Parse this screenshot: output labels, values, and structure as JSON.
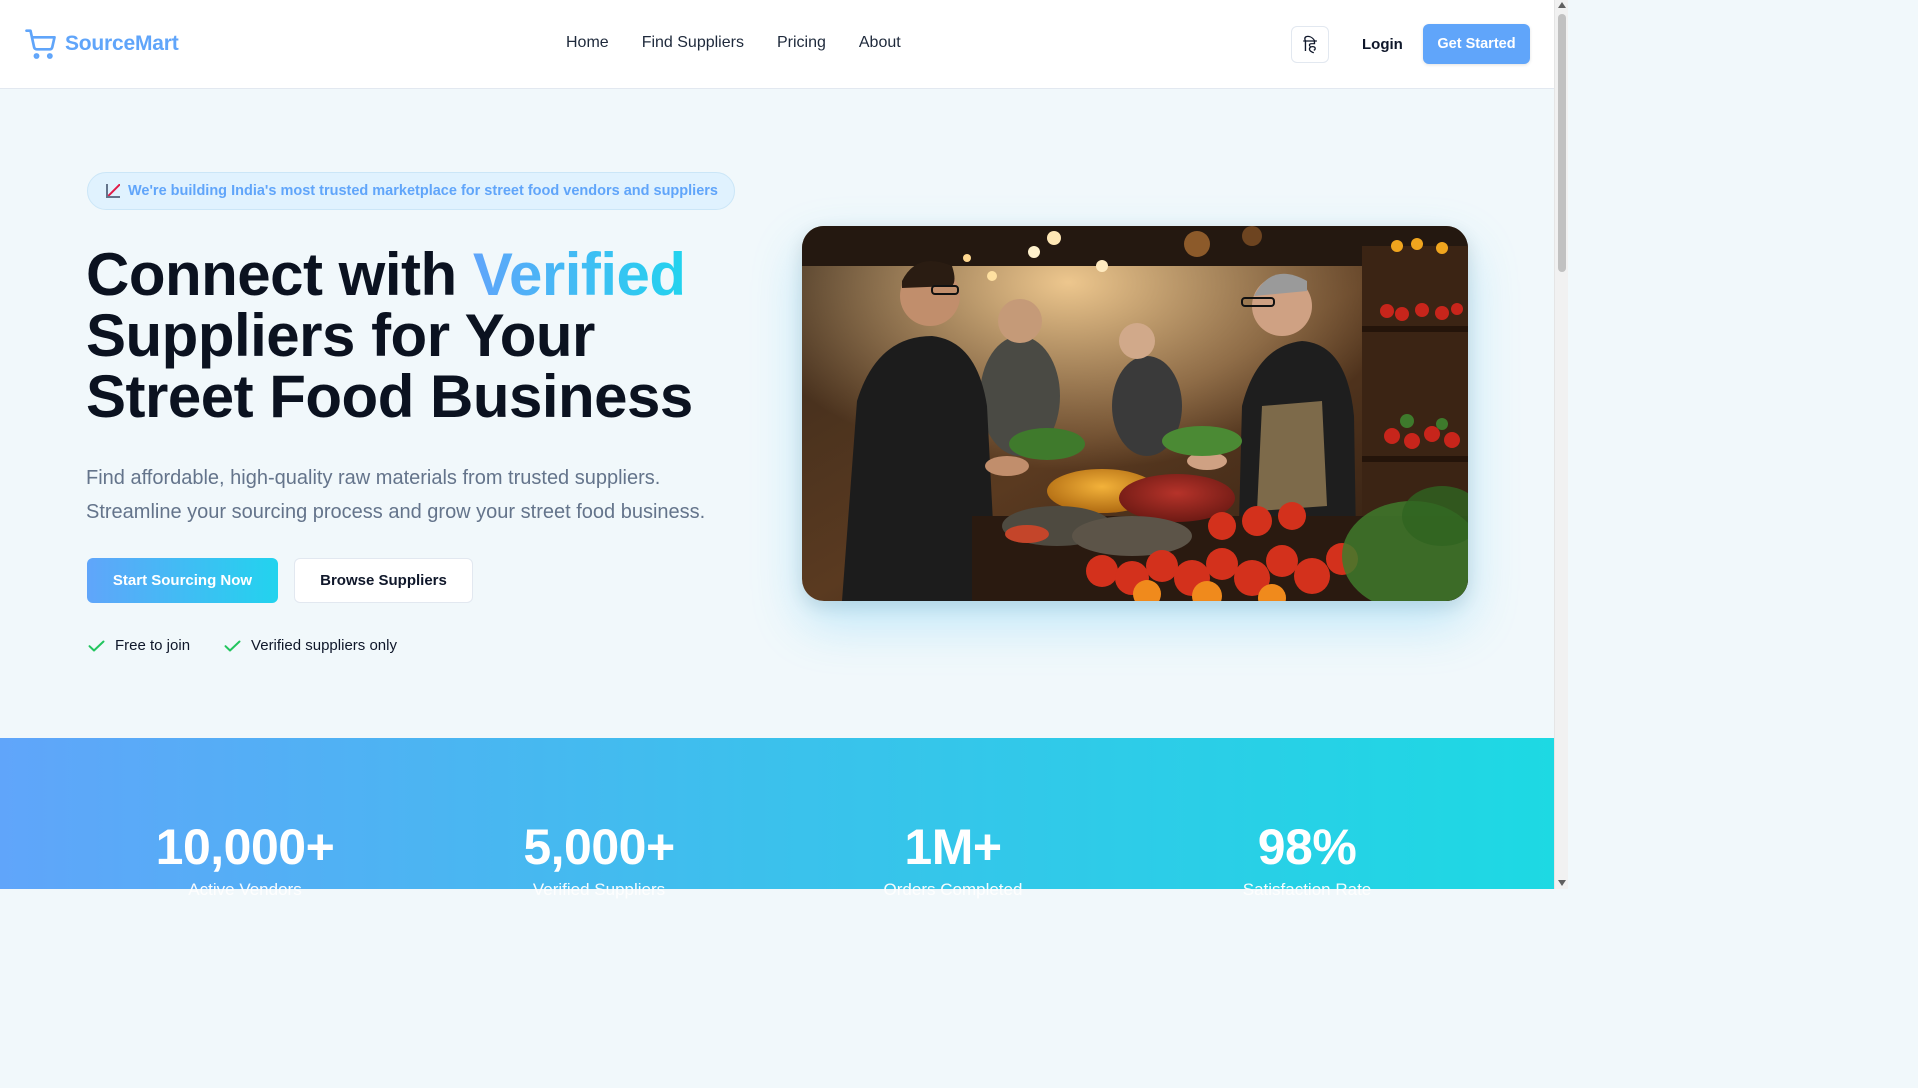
{
  "brand": {
    "name": "SourceMart",
    "icon": "shopping-cart-icon",
    "color": "#60a5fa"
  },
  "nav": {
    "items": [
      {
        "label": "Home"
      },
      {
        "label": "Find Suppliers"
      },
      {
        "label": "Pricing"
      },
      {
        "label": "About"
      }
    ],
    "language_toggle": "हि",
    "login": "Login",
    "get_started": "Get Started"
  },
  "hero": {
    "badge_icon": "chart-increasing-icon",
    "badge": "We're building India's most trusted marketplace for street food vendors and suppliers",
    "title_part1": "Connect with ",
    "title_accent": "Verified",
    "title_part2": "Suppliers for Your Street Food Business",
    "subtitle": "Find affordable, high-quality raw materials from trusted suppliers. Streamline your sourcing process and grow your street food business.",
    "primary_cta": "Start Sourcing Now",
    "secondary_cta": "Browse Suppliers",
    "checks": [
      {
        "icon": "check-icon",
        "label": "Free to join"
      },
      {
        "icon": "check-icon",
        "label": "Verified suppliers only"
      }
    ],
    "image_alt": "Vendors buying produce and spices at a market stall"
  },
  "stats": [
    {
      "value": "10,000+",
      "label": "Active Vendors"
    },
    {
      "value": "5,000+",
      "label": "Verified Suppliers"
    },
    {
      "value": "1M+",
      "label": "Orders Completed"
    },
    {
      "value": "98%",
      "label": "Satisfaction Rate"
    }
  ],
  "colors": {
    "accent": "#60a5fa",
    "accent_end": "#22d3ee",
    "check": "#22c55e",
    "text_dark": "#0f172a",
    "text_muted": "#64748b"
  }
}
